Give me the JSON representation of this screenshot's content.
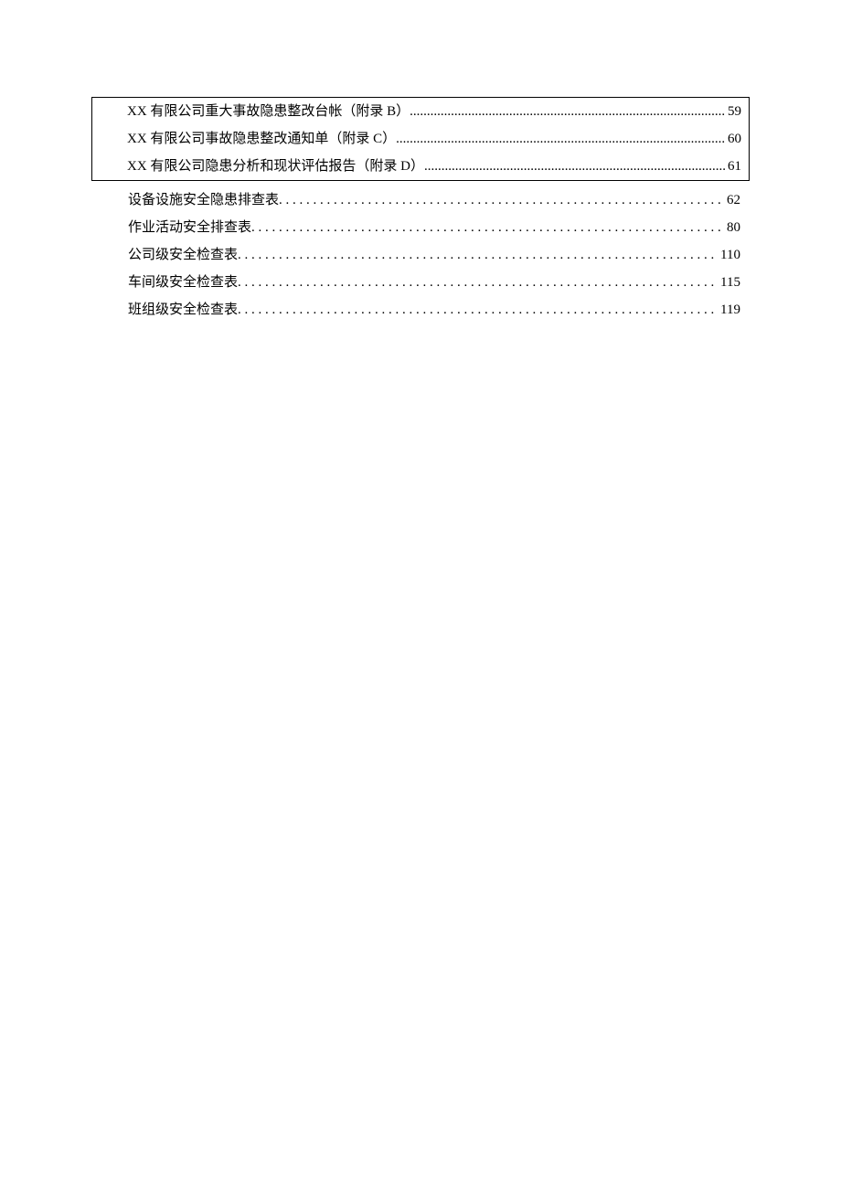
{
  "toc": {
    "boxed_entries": [
      {
        "label": "XX 有限公司重大事故隐患整改台帐（附录 B）",
        "page": "59"
      },
      {
        "label": "XX 有限公司事故隐患整改通知单（附录 C）",
        "page": "60"
      },
      {
        "label": "XX 有限公司隐患分析和现状评估报告（附录 D）",
        "page": "61"
      }
    ],
    "plain_entries": [
      {
        "label": "设备设施安全隐患排查表",
        "page": "62"
      },
      {
        "label": "作业活动安全排查表",
        "page": "80"
      },
      {
        "label": "公司级安全检查表",
        "page": "110"
      },
      {
        "label": "车间级安全检查表",
        "page": "115"
      },
      {
        "label": "班组级安全检查表",
        "page": "119"
      }
    ]
  }
}
